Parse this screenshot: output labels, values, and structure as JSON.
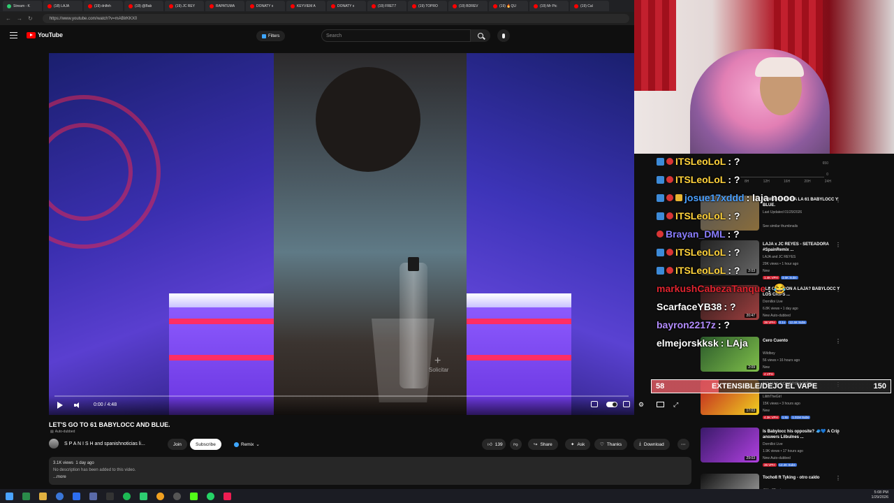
{
  "browser": {
    "tabs": [
      {
        "label": "Stream - K"
      },
      {
        "label": "(18) LAJA"
      },
      {
        "label": "(19) dnlfeh"
      },
      {
        "label": "(19) @Bab"
      },
      {
        "label": "(19) JC REY"
      },
      {
        "label": "RAPATUMA"
      },
      {
        "label": "DONATY x"
      },
      {
        "label": "KEYVIEM A"
      },
      {
        "label": "DONATY x"
      },
      {
        "label": "(19) FRET7"
      },
      {
        "label": "(19) TOPRO"
      },
      {
        "label": "(19) BDREV"
      },
      {
        "label": "(19) 🔥QU"
      },
      {
        "label": "(19) Mr Pic"
      },
      {
        "label": "(19) Cal"
      }
    ],
    "url": "https://www.youtube.com/watch?v=mABlrKKX0"
  },
  "youtube": {
    "logo": "YouTube",
    "filters_label": "Filters",
    "search_placeholder": "Search"
  },
  "player": {
    "time": "0:00 / 4:48",
    "progress": 0,
    "overlay_label": "Solicitar"
  },
  "video": {
    "title": "LET'S GO TO 61 BABYLOCC AND BLUE.",
    "dubbed": "Auto-dubbed",
    "channel": "S P A N I S H and spanishnoticias li...",
    "join_label": "Join",
    "subscribe_label": "Subscribe",
    "remix_label": "Remix",
    "likes": "139",
    "share_label": "Share",
    "ask_label": "Ask",
    "thanks_label": "Thanks",
    "download_label": "Download",
    "views": "3.1K views",
    "age": "1 day ago",
    "description": "No description has been added to this video.",
    "more_label": "...more"
  },
  "mini_chart": {
    "y_top": "650",
    "y_zero": "0",
    "x_labels": [
      "8H",
      "12H",
      "16H",
      "20H",
      "24H"
    ]
  },
  "recommendations": [
    {
      "title": "VAMOS PA PARA LA 61 BABYLOCC Y BLUE.",
      "meta1": "Last Updated 01/29/2026",
      "meta2": "",
      "meta3": "See similar thumbnails",
      "duration": ""
    },
    {
      "title": "LAJA x JC REYES - SETEADORA #SpainRemix ...",
      "meta1": "LAJA and JC REYES",
      "meta2": "29K views • 1 hour ago",
      "meta3": "New",
      "duration": "2:03",
      "chips": [
        "1.4K VPH",
        "3.6K Subs"
      ]
    },
    {
      "title": "¿LE CAYERON A LAJA? BABYLOCC Y LOS CRIPS ...",
      "meta1": "Dornilloi Live",
      "meta2": "6.8K views • 1 day ago",
      "meta3": "New  Auto-dubbed",
      "duration": "20:47",
      "chips": [
        "38 VPH",
        "0.1x",
        "12.4K Subs"
      ]
    },
    {
      "title": "Cero Cuento",
      "meta1": "Wildboy",
      "meta2": "56 views • 16 hours ago",
      "meta3": "New",
      "duration": "2:09",
      "chips": [
        "4 VPH"
      ]
    },
    {
      "title": "NO HAY CONSPIRACIÓN",
      "meta1": "LilithTheGirl",
      "meta2": "15K views • 3 hours ago",
      "meta3": "New",
      "duration": "17:03",
      "chips": [
        "4.3K VPH",
        "1.8x",
        "1.01M Subs"
      ]
    },
    {
      "title": "Is Babylocc his opposite? 🧢💙 A Crip answers Lilbulnes ...",
      "meta1": "Dornilloi Live",
      "meta2": "1.9K views • 17 hours ago",
      "meta3": "New  Auto-dubbed",
      "duration": "29:03",
      "chips": [
        "36 VPH",
        "12.4K Subs"
      ]
    },
    {
      "title": "Tocho8 ft Tyking - otro caldo",
      "meta1": "@Kar7Beat",
      "meta2": "",
      "meta3": "",
      "duration": ""
    }
  ],
  "chat": [
    {
      "user": "ITSLeoLoL",
      "text": " : ?",
      "color": "#ffd23b",
      "badges": [
        "b",
        "r"
      ]
    },
    {
      "user": "ITSLeoLoL",
      "text": " : ?",
      "color": "#ffd23b",
      "badges": [
        "b",
        "r"
      ]
    },
    {
      "user": "josue17xddd",
      "text": " : laja nooo",
      "color": "#4aa0ff",
      "badges": [
        "b",
        "r",
        "g"
      ]
    },
    {
      "user": "ITSLeoLoL",
      "text": " : ?",
      "color": "#ffd23b",
      "badges": [
        "b",
        "r"
      ]
    },
    {
      "user": "Brayan_DML",
      "text": " : ?",
      "color": "#8a7dff",
      "badges": [
        "r"
      ]
    },
    {
      "user": "ITSLeoLoL",
      "text": " : ?",
      "color": "#ffd23b",
      "badges": [
        "b",
        "r"
      ]
    },
    {
      "user": "ITSLeoLoL",
      "text": " : ?",
      "color": "#ffd23b",
      "badges": [
        "b",
        "r"
      ]
    },
    {
      "user": "markushCabezaTanque",
      "text": " : 😂",
      "color": "#e0242f",
      "badges": []
    },
    {
      "user": "ScarfaceYB38",
      "text": " : ?",
      "color": "#ffffff",
      "badges": []
    },
    {
      "user": "bayron2217z",
      "text": " : ?",
      "color": "#b38cff",
      "badges": []
    },
    {
      "user": "elmejorskksk",
      "text": " : LAja",
      "color": "#ffffff",
      "badges": []
    }
  ],
  "vote_bar": {
    "left": "58",
    "label": "EXTENSIBLE/DEJO EL VAPE",
    "right": "150",
    "fraction": 0.28
  },
  "tray": {
    "time": "5:08 PM",
    "date": "1/29/2026"
  },
  "colors": {
    "brand_red": "#ff0000",
    "accent_blue": "#3ea6ff",
    "bg": "#0f0f0f"
  }
}
